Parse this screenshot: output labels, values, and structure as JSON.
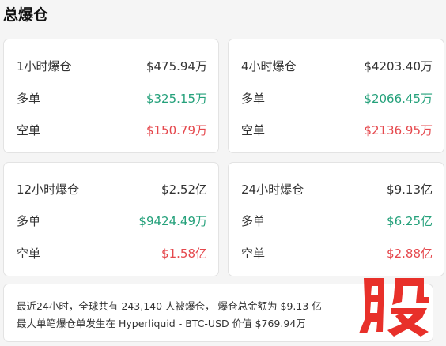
{
  "page": {
    "title": "总爆仓"
  },
  "cards": [
    {
      "period_label": "1小时爆仓",
      "period_value": "$475.94万",
      "long_label": "多单",
      "long_value": "$325.15万",
      "short_label": "空单",
      "short_value": "$150.79万"
    },
    {
      "period_label": "4小时爆仓",
      "period_value": "$4203.40万",
      "long_label": "多单",
      "long_value": "$2066.45万",
      "short_label": "空单",
      "short_value": "$2136.95万"
    },
    {
      "period_label": "12小时爆仓",
      "period_value": "$2.52亿",
      "long_label": "多单",
      "long_value": "$9424.49万",
      "short_label": "空单",
      "short_value": "$1.58亿"
    },
    {
      "period_label": "24小时爆仓",
      "period_value": "$9.13亿",
      "long_label": "多单",
      "long_value": "$6.25亿",
      "short_label": "空单",
      "short_value": "$2.88亿"
    }
  ],
  "summary": {
    "line1": "最近24小时，全球共有 243,140 人被爆仓， 爆仓总金额为 $9.13 亿",
    "line2": "最大单笔爆仓单发生在 Hyperliquid - BTC-USD 价值 $769.94万"
  },
  "watermark": {
    "char": "股"
  },
  "colors": {
    "long": "#25a17b",
    "short": "#e5484d",
    "watermark": "#e8302a"
  }
}
